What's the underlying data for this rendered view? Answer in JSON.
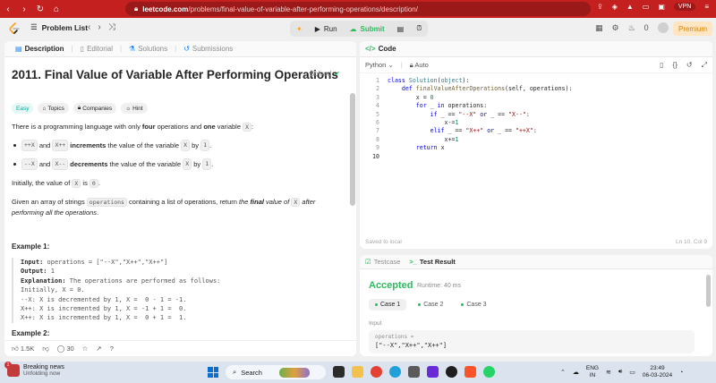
{
  "browser": {
    "url_domain": "leetcode.com",
    "url_path": "/problems/final-value-of-variable-after-performing-operations/description/",
    "vpn_label": "VPN"
  },
  "header": {
    "problem_list": "Problem List",
    "run": "Run",
    "submit": "Submit",
    "notifications": "0",
    "premium": "Premium"
  },
  "left": {
    "tabs": [
      {
        "label": "Description"
      },
      {
        "label": "Editorial"
      },
      {
        "label": "Solutions"
      },
      {
        "label": "Submissions"
      }
    ],
    "title": "2011. Final Value of Variable After Performing Operations",
    "solved": "Solved",
    "tags": [
      {
        "label": "Easy"
      },
      {
        "label": "Topics"
      },
      {
        "label": "Companies"
      },
      {
        "label": "Hint"
      }
    ],
    "intro": {
      "a": "There is a programming language with only ",
      "b": "four",
      "c": " operations and ",
      "d": "one",
      "e": " variable ",
      "f": "X",
      "g": ":"
    },
    "bullet1": {
      "c1": "++X",
      "and": " and ",
      "c2": "X++",
      "bold": "increments",
      "rest": " the value of the variable ",
      "c3": "X",
      "by": " by ",
      "c4": "1",
      "end": "."
    },
    "bullet2": {
      "c1": "--X",
      "and": " and ",
      "c2": "X--",
      "bold": "decrements",
      "rest": " the value of the variable ",
      "c3": "X",
      "by": " by ",
      "c4": "1",
      "end": "."
    },
    "initial": {
      "a": "Initially, the value of ",
      "c1": "X",
      "b": " is ",
      "c2": "0",
      "c": "."
    },
    "given": {
      "a": "Given an array of strings ",
      "c1": "operations",
      "b": " containing a list of operations, return ",
      "i1": "the ",
      "bold": "final",
      "i2": " value of ",
      "c2": "X",
      "i3": " after performing all the operations",
      "end": "."
    },
    "example1": {
      "heading": "Example 1:",
      "input_label": "Input:",
      "input_value": " operations = [\"--X\",\"X++\",\"X++\"]",
      "output_label": "Output:",
      "output_value": " 1",
      "expl_label": "Explanation:",
      "expl_value": " The operations are performed as follows:",
      "lines": [
        "Initially, X = 0.",
        "--X: X is decremented by 1, X =  0 - 1 = -1.",
        "X++: X is incremented by 1, X = -1 + 1 =  0.",
        "X++: X is incremented by 1, X =  0 + 1 =  1."
      ]
    },
    "example2_heading": "Example 2:",
    "footer": {
      "likes": "1.5K",
      "comments": "30"
    }
  },
  "code": {
    "tab": "Code",
    "language": "Python",
    "mode": "Auto",
    "lines": [
      "1",
      "2",
      "3",
      "4",
      "5",
      "6",
      "7",
      "8",
      "9",
      "10"
    ],
    "saved": "Saved to local",
    "cursor": "Ln 10, Col 9"
  },
  "result": {
    "tab_testcase": "Testcase",
    "tab_result": "Test Result",
    "status": "Accepted",
    "runtime": "Runtime: 40 ms",
    "cases": [
      "Case 1",
      "Case 2",
      "Case 3"
    ],
    "input_label": "Input",
    "input_name": "operations =",
    "input_value": "[\"--X\",\"X++\",\"X++\"]"
  },
  "taskbar": {
    "news_title": "Breaking news",
    "news_sub": "Unfolding now",
    "news_badge": "1",
    "search": "Search",
    "lang1": "ENG",
    "lang2": "IN",
    "time": "23:49",
    "date": "06-03-2024"
  }
}
